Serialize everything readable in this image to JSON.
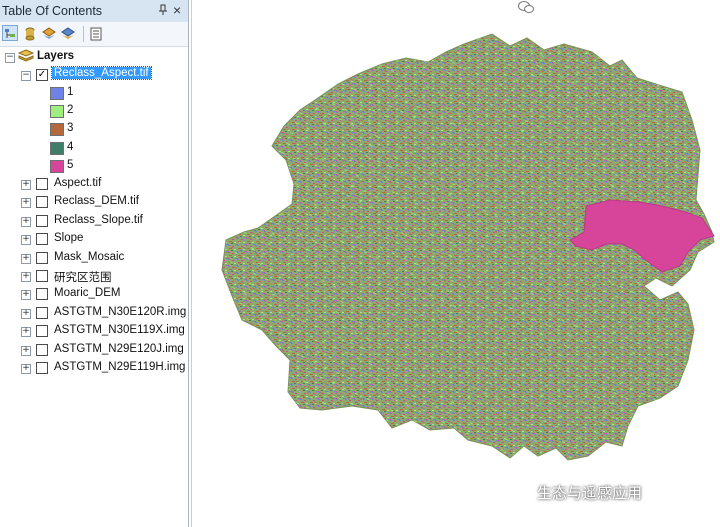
{
  "toc": {
    "title": "Table Of Contents",
    "pin_glyph": "📌",
    "close_glyph": "×",
    "toolbar_icons": [
      "list-by-drawing-order-icon",
      "list-by-source-icon",
      "list-by-visibility-icon",
      "list-by-selection-icon",
      "options-icon"
    ],
    "root": {
      "label": "Layers",
      "expanded": true
    },
    "active_layer": {
      "label": "Reclass_Aspect.tif",
      "checked": true,
      "expanded": true,
      "classes": [
        {
          "label": "1",
          "color": "#6f83e6"
        },
        {
          "label": "2",
          "color": "#9fef7f"
        },
        {
          "label": "3",
          "color": "#b5683e"
        },
        {
          "label": "4",
          "color": "#3f7f6a"
        },
        {
          "label": "5",
          "color": "#d6459a"
        }
      ]
    },
    "layers": [
      {
        "label": "Aspect.tif",
        "checked": false
      },
      {
        "label": "Reclass_DEM.tif",
        "checked": false
      },
      {
        "label": "Reclass_Slope.tif",
        "checked": false
      },
      {
        "label": "Slope",
        "checked": false
      },
      {
        "label": "Mask_Mosaic",
        "checked": false
      },
      {
        "label": "研究区范围",
        "checked": false
      },
      {
        "label": "Moaric_DEM",
        "checked": false
      },
      {
        "label": "ASTGTM_N30E120R.img",
        "checked": false
      },
      {
        "label": "ASTGTM_N30E119X.img",
        "checked": false
      },
      {
        "label": "ASTGTM_N29E120J.img",
        "checked": false
      },
      {
        "label": "ASTGTM_N29E119H.img",
        "checked": false
      }
    ]
  },
  "map": {
    "base_color": "#8fa86b",
    "texture_colors": [
      "#6f83e6",
      "#9fef7f",
      "#b5683e",
      "#3f7f6a",
      "#d6459a"
    ],
    "highlight_color": "#d6459a"
  },
  "watermark": {
    "text": "生态与遥感应用"
  }
}
